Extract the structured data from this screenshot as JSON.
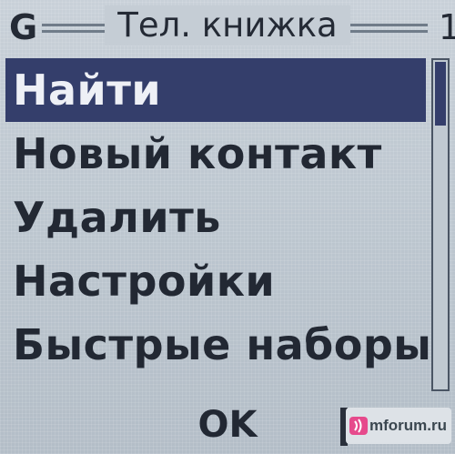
{
  "header": {
    "signal_indicator": "G",
    "title": "Тел. книжка",
    "page_indicator": "1"
  },
  "menu": {
    "items": [
      {
        "label": "Найти",
        "selected": true
      },
      {
        "label": "Новый контакт",
        "selected": false
      },
      {
        "label": "Удалить",
        "selected": false
      },
      {
        "label": "Настройки",
        "selected": false
      },
      {
        "label": "Быстрые наборы",
        "selected": false
      }
    ]
  },
  "softkeys": {
    "center_label": "OK"
  },
  "watermark": {
    "text": "mforum.ru"
  },
  "colors": {
    "selection": "#343e6b",
    "screen_background": "#bcc6cf",
    "text": "#222833"
  }
}
